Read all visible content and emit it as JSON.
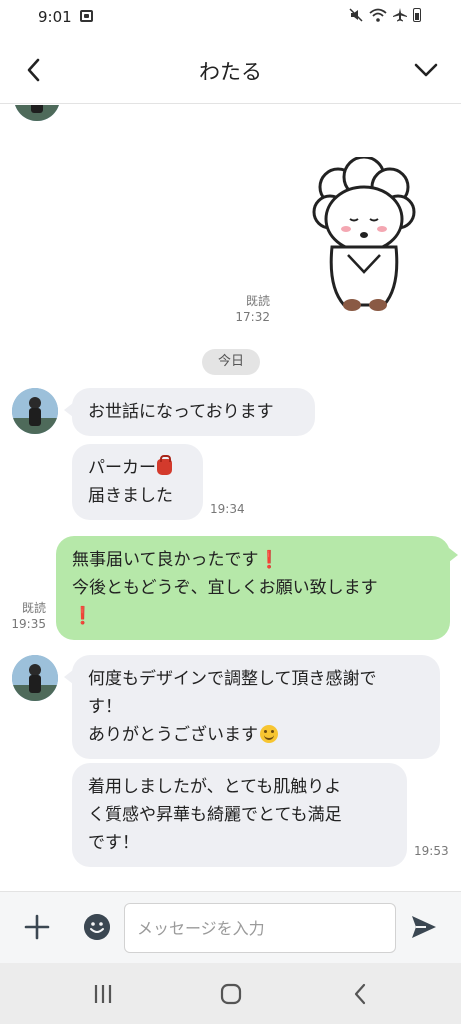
{
  "status_bar": {
    "time": "9:01",
    "icons": [
      "notification-icon",
      "mute-icon",
      "wifi-icon",
      "airplane-icon",
      "battery-icon"
    ]
  },
  "header": {
    "title": "わたる",
    "back_icon": "chevron-left-icon",
    "menu_icon": "chevron-down-icon"
  },
  "chat": {
    "sticker": {
      "description_icon": "bowing-sheep-sticker",
      "read_label": "既読",
      "time": "17:32"
    },
    "date_separator": "今日",
    "incoming_1": {
      "text": "お世話になっております"
    },
    "incoming_2": {
      "line1": "パーカー",
      "line2": "届きました",
      "time": "19:34"
    },
    "outgoing_1": {
      "line1": "無事届いて良かったです",
      "mark1": "❗",
      "line2": "今後ともどうぞ、宜しくお願い致します",
      "mark2": "❗",
      "read_label": "既読",
      "time": "19:35"
    },
    "incoming_3": {
      "line1": "何度もデザインで調整して頂き感謝で",
      "line2": "す！",
      "line3": "ありがとうございます"
    },
    "incoming_4": {
      "line1": "着用しましたが、とても肌触りよ",
      "line2": "く質感や昇華も綺麗でとても満足",
      "line3": "です！",
      "time": "19:53"
    }
  },
  "input_bar": {
    "placeholder": "メッセージを入力",
    "icons": [
      "plus-icon",
      "emoji-icon",
      "send-icon"
    ]
  },
  "nav_bar": {
    "icons": [
      "recent-apps-icon",
      "home-icon",
      "back-nav-icon"
    ]
  },
  "colors": {
    "outgoing_bubble": "#b6e8a9",
    "incoming_bubble": "#eeeff3",
    "accent_icon": "#3b4752"
  }
}
